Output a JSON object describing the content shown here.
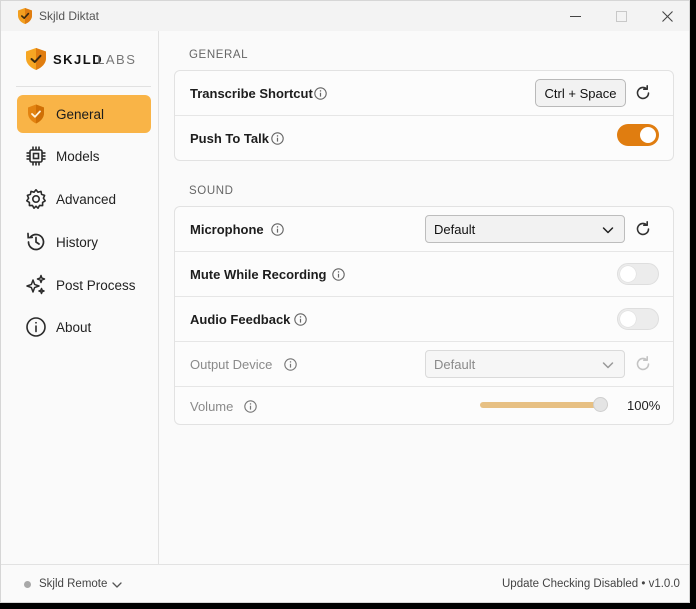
{
  "window": {
    "title": "Skjld Diktat"
  },
  "brand": {
    "name_strong": "SKJLD",
    "name_light": "LABS",
    "accent": "#f9b447",
    "toggle_on_color": "#e07d10"
  },
  "sidebar": {
    "items": [
      {
        "label": "General",
        "icon": "shield-check-icon",
        "active": true
      },
      {
        "label": "Models",
        "icon": "cpu-icon",
        "active": false
      },
      {
        "label": "Advanced",
        "icon": "gear-icon",
        "active": false
      },
      {
        "label": "History",
        "icon": "history-icon",
        "active": false
      },
      {
        "label": "Post Process",
        "icon": "sparkles-icon",
        "active": false
      },
      {
        "label": "About",
        "icon": "info-icon",
        "active": false
      }
    ]
  },
  "general": {
    "title": "GENERAL",
    "transcribe_shortcut": {
      "label": "Transcribe Shortcut",
      "value": "Ctrl + Space"
    },
    "push_to_talk": {
      "label": "Push To Talk",
      "enabled": true
    }
  },
  "sound": {
    "title": "SOUND",
    "microphone": {
      "label": "Microphone",
      "selected": "Default"
    },
    "mute_while_recording": {
      "label": "Mute While Recording",
      "enabled": false
    },
    "audio_feedback": {
      "label": "Audio Feedback",
      "enabled": false
    },
    "output_device": {
      "label": "Output Device",
      "selected": "Default",
      "disabled": true
    },
    "volume": {
      "label": "Volume",
      "value_text": "100%",
      "value": 1.0,
      "disabled": true
    }
  },
  "footer": {
    "remote_label": "Skjld Remote",
    "update_text": "Update Checking Disabled • v1.0.0"
  }
}
